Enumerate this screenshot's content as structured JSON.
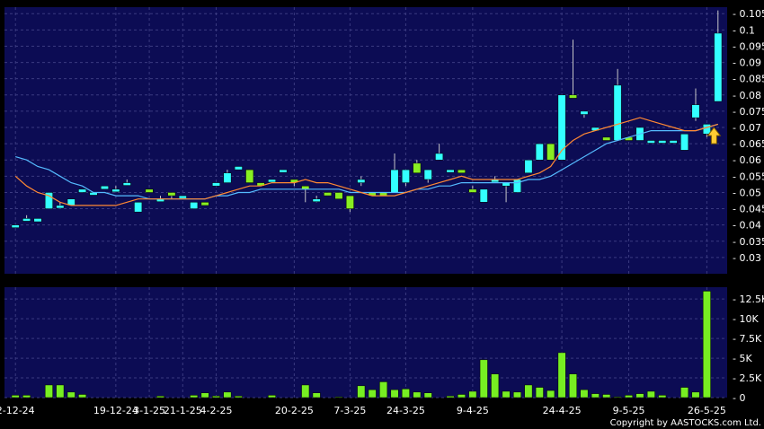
{
  "chart_data": [
    {
      "type": "candlestick",
      "panel": "price",
      "ylim": [
        0.025,
        0.107
      ],
      "y_ticks": [
        "0.105",
        "0.1",
        "0.095",
        "0.09",
        "0.085",
        "0.08",
        "0.075",
        "0.07",
        "0.065",
        "0.06",
        "0.055",
        "0.05",
        "0.045",
        "0.04",
        "0.035",
        "0.03"
      ],
      "grid": true,
      "colors": {
        "up": "#33ffff",
        "down": "#88ee22",
        "ma_short": "#ff8833",
        "ma_long": "#55bbff",
        "arrow": "#ffcc33"
      },
      "candles": [
        {
          "date": "2-12-24",
          "open": 0.04,
          "high": 0.04,
          "low": 0.04,
          "close": 0.04
        },
        {
          "date": "",
          "open": 0.042,
          "high": 0.043,
          "low": 0.042,
          "close": 0.042
        },
        {
          "date": "",
          "open": 0.041,
          "high": 0.042,
          "low": 0.041,
          "close": 0.042
        },
        {
          "date": "",
          "open": 0.045,
          "high": 0.05,
          "low": 0.045,
          "close": 0.05
        },
        {
          "date": "",
          "open": 0.046,
          "high": 0.047,
          "low": 0.046,
          "close": 0.046
        },
        {
          "date": "",
          "open": 0.046,
          "high": 0.048,
          "low": 0.046,
          "close": 0.048
        },
        {
          "date": "",
          "open": 0.05,
          "high": 0.051,
          "low": 0.05,
          "close": 0.051
        },
        {
          "date": "",
          "open": 0.05,
          "high": 0.05,
          "low": 0.05,
          "close": 0.05
        },
        {
          "date": "",
          "open": 0.051,
          "high": 0.052,
          "low": 0.051,
          "close": 0.052
        },
        {
          "date": "19-12-24",
          "open": 0.051,
          "high": 0.052,
          "low": 0.051,
          "close": 0.051
        },
        {
          "date": "",
          "open": 0.053,
          "high": 0.054,
          "low": 0.053,
          "close": 0.053
        },
        {
          "date": "",
          "open": 0.044,
          "high": 0.047,
          "low": 0.044,
          "close": 0.047
        },
        {
          "date": "3-1-25",
          "open": 0.051,
          "high": 0.051,
          "low": 0.05,
          "close": 0.05
        },
        {
          "date": "",
          "open": 0.048,
          "high": 0.049,
          "low": 0.048,
          "close": 0.048
        },
        {
          "date": "",
          "open": 0.05,
          "high": 0.05,
          "low": 0.048,
          "close": 0.049
        },
        {
          "date": "21-1-25",
          "open": 0.049,
          "high": 0.049,
          "low": 0.049,
          "close": 0.049
        },
        {
          "date": "",
          "open": 0.045,
          "high": 0.047,
          "low": 0.045,
          "close": 0.047
        },
        {
          "date": "",
          "open": 0.047,
          "high": 0.047,
          "low": 0.046,
          "close": 0.046
        },
        {
          "date": "4-2-25",
          "open": 0.052,
          "high": 0.053,
          "low": 0.052,
          "close": 0.053
        },
        {
          "date": "",
          "open": 0.053,
          "high": 0.057,
          "low": 0.053,
          "close": 0.056
        },
        {
          "date": "",
          "open": 0.057,
          "high": 0.058,
          "low": 0.057,
          "close": 0.058
        },
        {
          "date": "",
          "open": 0.057,
          "high": 0.057,
          "low": 0.053,
          "close": 0.053
        },
        {
          "date": "",
          "open": 0.053,
          "high": 0.053,
          "low": 0.052,
          "close": 0.052
        },
        {
          "date": "",
          "open": 0.054,
          "high": 0.054,
          "low": 0.054,
          "close": 0.054
        },
        {
          "date": "",
          "open": 0.057,
          "high": 0.057,
          "low": 0.057,
          "close": 0.057
        },
        {
          "date": "20-2-25",
          "open": 0.054,
          "high": 0.054,
          "low": 0.052,
          "close": 0.053
        },
        {
          "date": "",
          "open": 0.052,
          "high": 0.052,
          "low": 0.047,
          "close": 0.051
        },
        {
          "date": "",
          "open": 0.048,
          "high": 0.049,
          "low": 0.047,
          "close": 0.048
        },
        {
          "date": "",
          "open": 0.05,
          "high": 0.05,
          "low": 0.049,
          "close": 0.049
        },
        {
          "date": "",
          "open": 0.05,
          "high": 0.05,
          "low": 0.048,
          "close": 0.048
        },
        {
          "date": "7-3-25",
          "open": 0.049,
          "high": 0.049,
          "low": 0.044,
          "close": 0.045
        },
        {
          "date": "",
          "open": 0.053,
          "high": 0.055,
          "low": 0.052,
          "close": 0.054
        },
        {
          "date": "",
          "open": 0.05,
          "high": 0.05,
          "low": 0.049,
          "close": 0.049
        },
        {
          "date": "",
          "open": 0.05,
          "high": 0.05,
          "low": 0.049,
          "close": 0.049
        },
        {
          "date": "",
          "open": 0.05,
          "high": 0.062,
          "low": 0.05,
          "close": 0.057
        },
        {
          "date": "24-3-25",
          "open": 0.053,
          "high": 0.057,
          "low": 0.052,
          "close": 0.057
        },
        {
          "date": "",
          "open": 0.059,
          "high": 0.06,
          "low": 0.056,
          "close": 0.056
        },
        {
          "date": "",
          "open": 0.054,
          "high": 0.057,
          "low": 0.053,
          "close": 0.057
        },
        {
          "date": "",
          "open": 0.06,
          "high": 0.065,
          "low": 0.06,
          "close": 0.062
        },
        {
          "date": "",
          "open": 0.057,
          "high": 0.057,
          "low": 0.057,
          "close": 0.057
        },
        {
          "date": "",
          "open": 0.057,
          "high": 0.057,
          "low": 0.056,
          "close": 0.056
        },
        {
          "date": "9-4-25",
          "open": 0.051,
          "high": 0.052,
          "low": 0.05,
          "close": 0.05
        },
        {
          "date": "",
          "open": 0.047,
          "high": 0.051,
          "low": 0.047,
          "close": 0.051
        },
        {
          "date": "",
          "open": 0.054,
          "high": 0.055,
          "low": 0.054,
          "close": 0.054
        },
        {
          "date": "",
          "open": 0.052,
          "high": 0.053,
          "low": 0.047,
          "close": 0.053
        },
        {
          "date": "",
          "open": 0.05,
          "high": 0.054,
          "low": 0.05,
          "close": 0.054
        },
        {
          "date": "",
          "open": 0.056,
          "high": 0.06,
          "low": 0.056,
          "close": 0.06
        },
        {
          "date": "",
          "open": 0.06,
          "high": 0.065,
          "low": 0.06,
          "close": 0.065
        },
        {
          "date": "",
          "open": 0.065,
          "high": 0.065,
          "low": 0.06,
          "close": 0.06
        },
        {
          "date": "24-4-25",
          "open": 0.06,
          "high": 0.08,
          "low": 0.06,
          "close": 0.08
        },
        {
          "date": "",
          "open": 0.08,
          "high": 0.097,
          "low": 0.079,
          "close": 0.079
        },
        {
          "date": "",
          "open": 0.074,
          "high": 0.075,
          "low": 0.073,
          "close": 0.075
        },
        {
          "date": "",
          "open": 0.069,
          "high": 0.07,
          "low": 0.069,
          "close": 0.07
        },
        {
          "date": "",
          "open": 0.067,
          "high": 0.067,
          "low": 0.066,
          "close": 0.066
        },
        {
          "date": "",
          "open": 0.066,
          "high": 0.088,
          "low": 0.066,
          "close": 0.083
        },
        {
          "date": "9-5-25",
          "open": 0.067,
          "high": 0.067,
          "low": 0.066,
          "close": 0.066
        },
        {
          "date": "",
          "open": 0.066,
          "high": 0.07,
          "low": 0.066,
          "close": 0.07
        },
        {
          "date": "",
          "open": 0.066,
          "high": 0.066,
          "low": 0.066,
          "close": 0.066
        },
        {
          "date": "",
          "open": 0.066,
          "high": 0.066,
          "low": 0.066,
          "close": 0.066
        },
        {
          "date": "",
          "open": 0.066,
          "high": 0.066,
          "low": 0.066,
          "close": 0.066
        },
        {
          "date": "",
          "open": 0.063,
          "high": 0.068,
          "low": 0.063,
          "close": 0.068
        },
        {
          "date": "",
          "open": 0.073,
          "high": 0.082,
          "low": 0.072,
          "close": 0.077
        },
        {
          "date": "26-5-25",
          "open": 0.068,
          "high": 0.071,
          "low": 0.067,
          "close": 0.071
        },
        {
          "date": "",
          "open": 0.078,
          "high": 0.106,
          "low": 0.078,
          "close": 0.099
        }
      ],
      "ma_short": [
        0.055,
        0.052,
        0.05,
        0.049,
        0.047,
        0.046,
        0.046,
        0.046,
        0.046,
        0.046,
        0.047,
        0.048,
        0.048,
        0.048,
        0.048,
        0.048,
        0.048,
        0.048,
        0.049,
        0.05,
        0.051,
        0.052,
        0.052,
        0.053,
        0.053,
        0.053,
        0.054,
        0.053,
        0.053,
        0.052,
        0.051,
        0.05,
        0.049,
        0.049,
        0.049,
        0.05,
        0.051,
        0.052,
        0.053,
        0.054,
        0.055,
        0.054,
        0.054,
        0.054,
        0.054,
        0.054,
        0.055,
        0.056,
        0.058,
        0.063,
        0.066,
        0.068,
        0.069,
        0.07,
        0.071,
        0.072,
        0.073,
        0.072,
        0.071,
        0.07,
        0.069,
        0.069,
        0.07,
        0.071
      ],
      "ma_long": [
        0.061,
        0.06,
        0.058,
        0.057,
        0.055,
        0.053,
        0.052,
        0.05,
        0.05,
        0.049,
        0.049,
        0.049,
        0.048,
        0.048,
        0.048,
        0.048,
        0.048,
        0.048,
        0.049,
        0.049,
        0.05,
        0.05,
        0.051,
        0.051,
        0.051,
        0.051,
        0.051,
        0.051,
        0.051,
        0.051,
        0.05,
        0.05,
        0.05,
        0.05,
        0.05,
        0.05,
        0.051,
        0.051,
        0.052,
        0.052,
        0.053,
        0.053,
        0.053,
        0.053,
        0.053,
        0.053,
        0.054,
        0.054,
        0.055,
        0.057,
        0.059,
        0.061,
        0.063,
        0.065,
        0.066,
        0.067,
        0.068,
        0.069,
        0.069,
        0.069,
        0.069,
        0.069,
        0.07,
        0.071
      ]
    },
    {
      "type": "bar",
      "panel": "volume",
      "ylim": [
        0,
        14000
      ],
      "y_ticks": [
        "12.5K",
        "10K",
        "7.5K",
        "5K",
        "2.5K",
        "0"
      ],
      "values": [
        300,
        300,
        0,
        1600,
        1600,
        700,
        400,
        0,
        0,
        0,
        0,
        0,
        0,
        200,
        0,
        0,
        300,
        600,
        200,
        700,
        200,
        0,
        0,
        300,
        0,
        0,
        1600,
        600,
        0,
        100,
        0,
        1500,
        1000,
        2000,
        1000,
        1100,
        700,
        600,
        0,
        200,
        400,
        800,
        4800,
        3000,
        800,
        700,
        1600,
        1300,
        900,
        5700,
        3000,
        1000,
        500,
        400,
        100,
        300,
        500,
        800,
        300,
        0,
        1300,
        700,
        13500
      ],
      "bar_color": "#77ee22"
    }
  ],
  "copyright": "Copyright by AASTOCKS.com Ltd."
}
